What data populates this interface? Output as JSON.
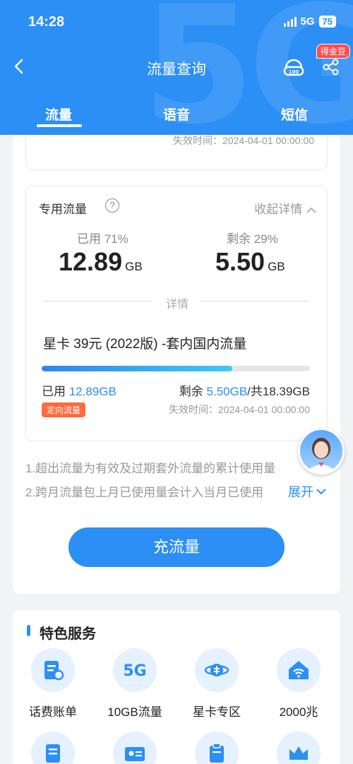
{
  "status_bar": {
    "time": "14:28",
    "network": "5G",
    "battery": "75"
  },
  "header": {
    "title": "流量查询",
    "coin_badge": "得金豆",
    "tabs": [
      {
        "label": "流量"
      },
      {
        "label": "语音"
      },
      {
        "label": "短信"
      }
    ]
  },
  "previous_item": {
    "expire_text": "失效时间：2024-04-01 00:00:00"
  },
  "dedicated": {
    "title": "专用流量",
    "help_symbol": "?",
    "collapse_label": "收起详情",
    "used_label": "已用 71%",
    "used_value": "12.89",
    "used_unit": "GB",
    "remaining_label": "剩余 29%",
    "remaining_value": "5.50",
    "remaining_unit": "GB",
    "divider_label": "详情",
    "package_name": "星卡 39元 (2022版) -套内国内流量",
    "progress_used_fraction": 0.71,
    "used_prefix": "已用 ",
    "used_amount": "12.89GB",
    "remaining_prefix": "剩余 ",
    "remaining_amount": "5.50GB",
    "total": "/共18.39GB",
    "tag": "定向流量",
    "expire_text": "失效时间：2024-04-01 00:00:00"
  },
  "notes": [
    "1.超出流量为有效及过期套外流量的累计使用量",
    "2.跨月流量包上月已使用量会计入当月已使用"
  ],
  "expand_label": "展开",
  "cta_label": "充流量",
  "services": {
    "title": "特色服务",
    "items": [
      {
        "label": "话费账单",
        "icon": "bill-icon"
      },
      {
        "label": "10GB流量",
        "icon": "5g-icon"
      },
      {
        "label": "星卡专区",
        "icon": "star-card-icon"
      },
      {
        "label": "2000兆",
        "icon": "wifi-home-icon"
      },
      {
        "label": "",
        "icon": "document-icon"
      },
      {
        "label": "",
        "icon": "id-card-icon"
      },
      {
        "label": "",
        "icon": "clipboard-icon"
      },
      {
        "label": "",
        "icon": "crown-icon"
      }
    ],
    "icon_color": "#2b8ff5"
  },
  "colors": {
    "primary": "#2b8ff5",
    "tag": "#ff6a3d",
    "badge": "#ff4d4f"
  }
}
